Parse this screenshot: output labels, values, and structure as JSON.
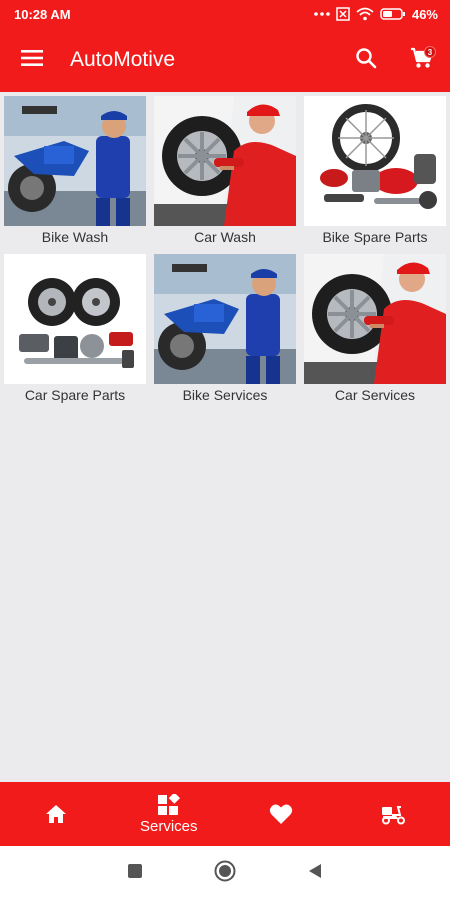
{
  "status_bar": {
    "time": "10:28 AM",
    "battery": "46%"
  },
  "app_bar": {
    "title": "AutoMotive",
    "cart_count": "3",
    "icons": [
      "menu-icon",
      "search-icon",
      "cart-icon"
    ]
  },
  "categories": [
    {
      "label": "Bike Wash",
      "image": "bike-mechanic-image"
    },
    {
      "label": "Car Wash",
      "image": "car-wheel-mechanic-image"
    },
    {
      "label": "Bike Spare Parts",
      "image": "bike-parts-image"
    },
    {
      "label": "Car Spare Parts",
      "image": "car-parts-image"
    },
    {
      "label": "Bike Services",
      "image": "bike-mechanic-image"
    },
    {
      "label": "Car Services",
      "image": "car-wheel-mechanic-image"
    }
  ],
  "bottom_nav": {
    "items": [
      {
        "label": "",
        "icon": "home-icon"
      },
      {
        "label": "Services",
        "icon": "services-icon",
        "active": true
      },
      {
        "label": "",
        "icon": "heart-icon"
      },
      {
        "label": "",
        "icon": "delivery-scooter-icon"
      }
    ]
  },
  "colors": {
    "primary": "#f21b1b",
    "background": "#ebebed",
    "text": "#333333"
  }
}
